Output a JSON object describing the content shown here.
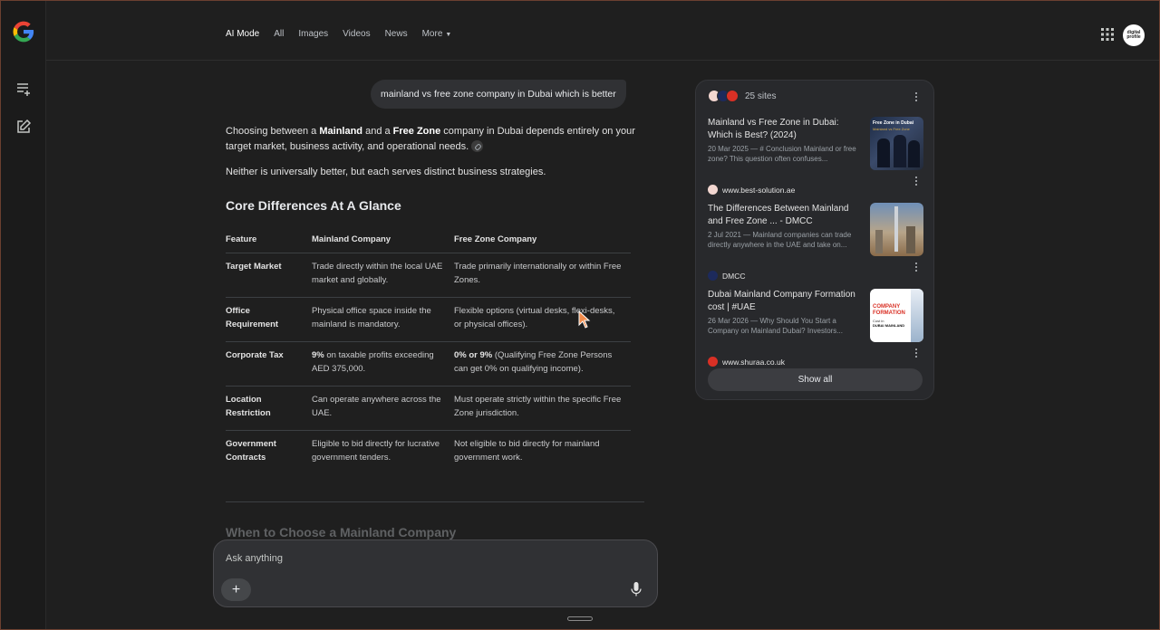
{
  "nav": {
    "tabs": [
      "AI Mode",
      "All",
      "Images",
      "Videos",
      "News",
      "More"
    ],
    "active_tab": "AI Mode"
  },
  "profile": {
    "avatar_text_1": "digital",
    "avatar_text_2": "profile"
  },
  "query": {
    "text": "mainland vs free zone company in Dubai which is better"
  },
  "answer": {
    "intro_prefix": "Choosing between a ",
    "intro_bold1": "Mainland",
    "intro_mid": " and a ",
    "intro_bold2": "Free Zone",
    "intro_suffix": " company in Dubai depends entirely on your target market, business activity, and operational needs.",
    "second": "Neither is universally better, but each serves distinct business strategies.",
    "heading": "Core Differences At A Glance",
    "table": {
      "headers": [
        "Feature",
        "Mainland Company",
        "Free Zone Company"
      ],
      "rows": [
        {
          "feature": "Target Market",
          "mainland": "Trade directly within the local UAE market and globally.",
          "freezone": "Trade primarily internationally or within Free Zones."
        },
        {
          "feature": "Office Requirement",
          "mainland": "Physical office space inside the mainland is mandatory.",
          "freezone": "Flexible options (virtual desks, flexi-desks, or physical offices)."
        },
        {
          "feature": "Corporate Tax",
          "mainland_bold": "9%",
          "mainland": " on taxable profits exceeding AED 375,000.",
          "freezone_bold": "0% or 9%",
          "freezone": " (Qualifying Free Zone Persons can get 0% on qualifying income)."
        },
        {
          "feature": "Location Restriction",
          "mainland": "Can operate anywhere across the UAE.",
          "freezone": "Must operate strictly within the specific Free Zone jurisdiction."
        },
        {
          "feature": "Government Contracts",
          "mainland": "Eligible to bid directly for lucrative government tenders.",
          "freezone": "Not eligible to bid directly for mainland government work."
        }
      ]
    },
    "next_heading": "When to Choose a Mainland Company"
  },
  "ask": {
    "placeholder": "Ask anything"
  },
  "sources": {
    "count_label": "25 sites",
    "items": [
      {
        "title": "Mainland vs Free Zone in Dubai: Which is Best? (2024)",
        "snippet": "20 Mar 2025 — # Conclusion Mainland or free zone? This question often confuses...",
        "site": "www.best-solution.ae",
        "fav_color": "#f2d6d0"
      },
      {
        "title": "The Differences Between Mainland and Free Zone ... - DMCC",
        "snippet": "2 Jul 2021 — Mainland companies can trade directly anywhere in the UAE and take on...",
        "site": "DMCC",
        "fav_color": "#1d2a5c"
      },
      {
        "title": "Dubai Mainland Company Formation cost | #UAE",
        "snippet": "26 Mar 2026 — Why Should You Start a Company on Mainland Dubai? Investors...",
        "site": "www.shuraa.co.uk",
        "fav_color": "#d93025"
      }
    ],
    "show_all": "Show all"
  },
  "thumb1": {
    "line1": "Free Zone in Dubai",
    "line2": "Mainland vs Free Zone"
  },
  "thumb3": {
    "line1": "COMPANY",
    "line2": "FORMATION",
    "line3": "Cost in",
    "line4": "DUBAI MAINLAND"
  }
}
